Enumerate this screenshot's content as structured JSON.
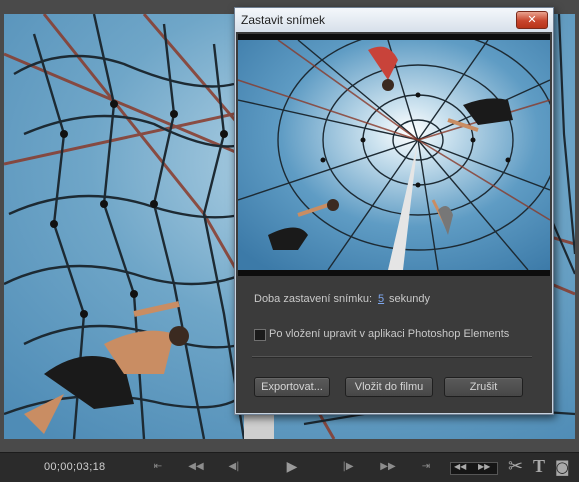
{
  "dialog": {
    "title": "Zastavit snímek",
    "close_glyph": "✕",
    "duration_label": "Doba zastavení snímku:",
    "duration_value": "5",
    "duration_unit": "sekundy",
    "checkbox_label": "Po vložení upravit v aplikaci Photoshop Elements",
    "checkbox_checked": false,
    "buttons": {
      "export": "Exportovat...",
      "insert": "Vložit do filmu",
      "cancel": "Zrušit"
    }
  },
  "transport": {
    "timecode": "00;00;03;18",
    "icons": [
      "go-to-start-icon",
      "rewind-icon",
      "step-back-icon",
      "play-icon",
      "step-forward-icon",
      "fast-forward-icon",
      "go-to-end-icon"
    ],
    "tools": [
      "scissors-icon",
      "text-icon",
      "freeze-frame-icon"
    ]
  },
  "colors": {
    "sky": "#5f9cc4",
    "panel": "#3b3b3b",
    "titlebar": "#e4e9f0",
    "close": "#c8452c",
    "link": "#7ea7ee"
  }
}
